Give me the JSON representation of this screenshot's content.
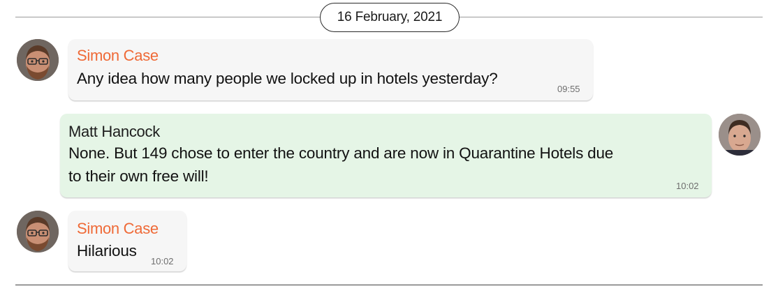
{
  "date_divider": "16 February, 2021",
  "messages": [
    {
      "sender": "Simon Case",
      "text": "Any idea how many people we locked up in hotels yesterday?",
      "time": "09:55",
      "direction": "incoming",
      "sender_color": "#ef6a37"
    },
    {
      "sender": "Matt Hancock",
      "text_line1": "None. But 149 chose to enter the country and are now in Quarantine Hotels due",
      "text_line2": "to their own free will!",
      "time": "10:02",
      "direction": "outgoing",
      "bubble_color": "#e5f5e6"
    },
    {
      "sender": "Simon Case",
      "text": "Hilarious",
      "time": "10:02",
      "direction": "incoming",
      "sender_color": "#ef6a37"
    }
  ],
  "avatars": {
    "simon_case": "avatar-bearded-man-glasses",
    "matt_hancock": "avatar-man-short-hair"
  }
}
